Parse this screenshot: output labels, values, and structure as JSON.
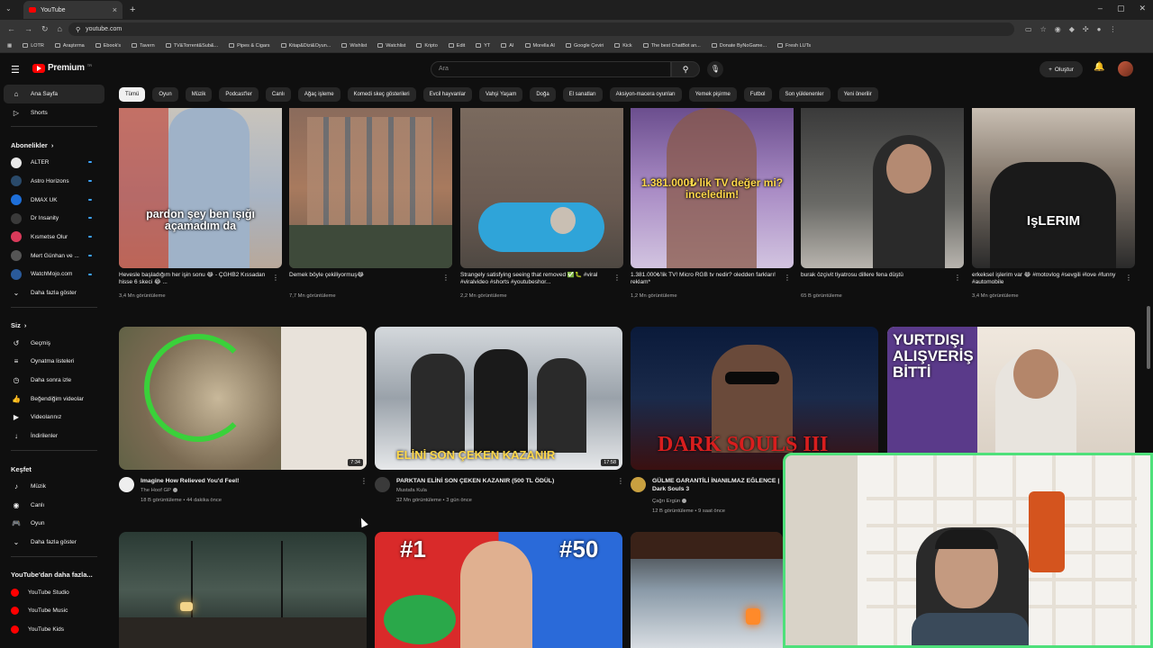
{
  "browser": {
    "tab_title": "YouTube",
    "url": "youtube.com",
    "bookmarks": [
      "LOTR",
      "Araştırma",
      "Ebook's",
      "Tavern",
      "TV&Torrent&Sub&...",
      "Pipes & Cigars",
      "Kitap&Dizi&Oyun...",
      "Wishlist",
      "Watchlist",
      "Kripto",
      "Edit",
      "YT",
      "AI",
      "Morella AI",
      "Google Çeviri",
      "Kick",
      "The best ChatBot an...",
      "Donate ByNoGame...",
      "Fresh LUTs"
    ]
  },
  "header": {
    "logo_text": "Premium",
    "logo_tm": "TR",
    "search_placeholder": "Ara",
    "create_label": "Oluştur"
  },
  "sidebar": {
    "top": [
      {
        "label": "Ana Sayfa",
        "icon": "home-icon",
        "active": true
      },
      {
        "label": "Shorts",
        "icon": "shorts-icon"
      }
    ],
    "subs_title": "Abonelikler",
    "subs": [
      {
        "label": "ALTER",
        "color": "#e8e8e8"
      },
      {
        "label": "Astro Horizons",
        "color": "#2a4a6a"
      },
      {
        "label": "DMAX UK",
        "color": "#1e6fd9"
      },
      {
        "label": "Dr Insanity",
        "color": "#3a3a3a"
      },
      {
        "label": "Kısmetse Olur",
        "color": "#d93a5a"
      },
      {
        "label": "Mert Günhan ve ...",
        "color": "#555555"
      },
      {
        "label": "WatchMojo.com",
        "color": "#2a5a9a"
      }
    ],
    "subs_more": "Daha fazla göster",
    "you_title": "Siz",
    "you": [
      {
        "label": "Geçmiş",
        "icon": "history-icon"
      },
      {
        "label": "Oynatma listeleri",
        "icon": "playlist-icon"
      },
      {
        "label": "Daha sonra izle",
        "icon": "clock-icon"
      },
      {
        "label": "Beğendiğim videolar",
        "icon": "like-icon"
      },
      {
        "label": "Videolarınız",
        "icon": "video-icon"
      },
      {
        "label": "İndirilenler",
        "icon": "download-icon"
      }
    ],
    "explore_title": "Keşfet",
    "explore": [
      {
        "label": "Müzik",
        "icon": "music-icon"
      },
      {
        "label": "Canlı",
        "icon": "live-icon"
      },
      {
        "label": "Oyun",
        "icon": "game-icon"
      }
    ],
    "explore_more": "Daha fazla göster",
    "more_title": "YouTube'dan daha fazla...",
    "more": [
      {
        "label": "YouTube Studio"
      },
      {
        "label": "YouTube Music"
      },
      {
        "label": "YouTube Kids"
      }
    ]
  },
  "chips": [
    "Tümü",
    "Oyun",
    "Müzik",
    "Podcast'ler",
    "Canlı",
    "Ağaç işleme",
    "Komedi skeç gösterileri",
    "Evcil hayvanlar",
    "Vahşi Yaşam",
    "Doğa",
    "El sanatları",
    "Aksiyon-macera oyunları",
    "Yemek pişirme",
    "Futbol",
    "Son yüklenenler",
    "Yeni önerilir"
  ],
  "shorts": [
    {
      "title": "Heveslе başladığım her işin sonu 😂 - ÇGHB2 Kıssadan hisse 6 skeci 😂 ...",
      "views": "3,4 Mn görüntüleme",
      "caption": "pardon şey ben ışığı açamadım da"
    },
    {
      "title": "Demek böyle çekiliyormuş😂",
      "views": "7,7 Mn görüntüleme",
      "caption": ""
    },
    {
      "title": "Strangely satisfying seeing that removed ✅🐛 #viral #viralvideo #shorts #youtubeshor...",
      "views": "2,2 Mn görüntüleme",
      "caption": ""
    },
    {
      "title": "1.381.000₺'lik TV! Micro RGB tv nedir? oledden farkları! reklam*",
      "views": "1,2 Mn görüntüleme",
      "caption": "1.381.000₺'lik TV değer mi? inceledim!"
    },
    {
      "title": "burak özçivit tiyatrosu dillere fena düştü",
      "views": "65 B görüntüleme",
      "caption": ""
    },
    {
      "title": "erkekseI işlerim var 😂 #motovlog #sevgili #love #funny #automobile",
      "views": "3,4 Mn görüntüleme",
      "caption": "IşLERIM"
    }
  ],
  "videos": [
    {
      "title": "Imagine How Relieved You'd Feel!",
      "channel": "The Hoof GP",
      "meta": "18 B görüntüleme • 44 dakika önce",
      "duration": "7:34",
      "thumb_text": ""
    },
    {
      "title": "PARKTAN ELİNİ SON ÇEKEN KAZANIR (500 TL ÖDÜL)",
      "channel": "Mustafa Kula",
      "meta": "32 Mn görüntüleme • 3 gün önce",
      "duration": "17:58",
      "thumb_text": "ELİNİ SON ÇEKEN KAZANIR"
    },
    {
      "title": "GÜLME GARANTİLİ İNANILMAZ EĞLENCE | Dark Souls 3",
      "channel": "Çağrı Ergün",
      "meta": "12 B görüntüleme • 9 saat önce",
      "duration": "",
      "thumb_text": "DARK SOULS III"
    },
    {
      "title": "",
      "channel": "",
      "meta": "",
      "duration": "",
      "thumb_text": "YURTDIŞI ALIŞVERİŞ BİTTİ"
    }
  ],
  "bottom_row": [
    {
      "thumb_text": ""
    },
    {
      "thumb_text_left": "#1",
      "thumb_text_right": "#50"
    },
    {
      "thumb_text": ""
    }
  ]
}
